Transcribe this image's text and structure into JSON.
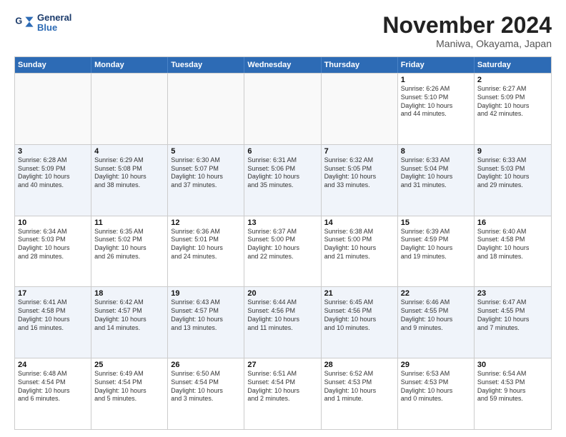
{
  "logo": {
    "line1": "General",
    "line2": "Blue"
  },
  "title": "November 2024",
  "location": "Maniwa, Okayama, Japan",
  "header_days": [
    "Sunday",
    "Monday",
    "Tuesday",
    "Wednesday",
    "Thursday",
    "Friday",
    "Saturday"
  ],
  "weeks": [
    [
      {
        "day": "",
        "info": ""
      },
      {
        "day": "",
        "info": ""
      },
      {
        "day": "",
        "info": ""
      },
      {
        "day": "",
        "info": ""
      },
      {
        "day": "",
        "info": ""
      },
      {
        "day": "1",
        "info": "Sunrise: 6:26 AM\nSunset: 5:10 PM\nDaylight: 10 hours\nand 44 minutes."
      },
      {
        "day": "2",
        "info": "Sunrise: 6:27 AM\nSunset: 5:09 PM\nDaylight: 10 hours\nand 42 minutes."
      }
    ],
    [
      {
        "day": "3",
        "info": "Sunrise: 6:28 AM\nSunset: 5:09 PM\nDaylight: 10 hours\nand 40 minutes."
      },
      {
        "day": "4",
        "info": "Sunrise: 6:29 AM\nSunset: 5:08 PM\nDaylight: 10 hours\nand 38 minutes."
      },
      {
        "day": "5",
        "info": "Sunrise: 6:30 AM\nSunset: 5:07 PM\nDaylight: 10 hours\nand 37 minutes."
      },
      {
        "day": "6",
        "info": "Sunrise: 6:31 AM\nSunset: 5:06 PM\nDaylight: 10 hours\nand 35 minutes."
      },
      {
        "day": "7",
        "info": "Sunrise: 6:32 AM\nSunset: 5:05 PM\nDaylight: 10 hours\nand 33 minutes."
      },
      {
        "day": "8",
        "info": "Sunrise: 6:33 AM\nSunset: 5:04 PM\nDaylight: 10 hours\nand 31 minutes."
      },
      {
        "day": "9",
        "info": "Sunrise: 6:33 AM\nSunset: 5:03 PM\nDaylight: 10 hours\nand 29 minutes."
      }
    ],
    [
      {
        "day": "10",
        "info": "Sunrise: 6:34 AM\nSunset: 5:03 PM\nDaylight: 10 hours\nand 28 minutes."
      },
      {
        "day": "11",
        "info": "Sunrise: 6:35 AM\nSunset: 5:02 PM\nDaylight: 10 hours\nand 26 minutes."
      },
      {
        "day": "12",
        "info": "Sunrise: 6:36 AM\nSunset: 5:01 PM\nDaylight: 10 hours\nand 24 minutes."
      },
      {
        "day": "13",
        "info": "Sunrise: 6:37 AM\nSunset: 5:00 PM\nDaylight: 10 hours\nand 22 minutes."
      },
      {
        "day": "14",
        "info": "Sunrise: 6:38 AM\nSunset: 5:00 PM\nDaylight: 10 hours\nand 21 minutes."
      },
      {
        "day": "15",
        "info": "Sunrise: 6:39 AM\nSunset: 4:59 PM\nDaylight: 10 hours\nand 19 minutes."
      },
      {
        "day": "16",
        "info": "Sunrise: 6:40 AM\nSunset: 4:58 PM\nDaylight: 10 hours\nand 18 minutes."
      }
    ],
    [
      {
        "day": "17",
        "info": "Sunrise: 6:41 AM\nSunset: 4:58 PM\nDaylight: 10 hours\nand 16 minutes."
      },
      {
        "day": "18",
        "info": "Sunrise: 6:42 AM\nSunset: 4:57 PM\nDaylight: 10 hours\nand 14 minutes."
      },
      {
        "day": "19",
        "info": "Sunrise: 6:43 AM\nSunset: 4:57 PM\nDaylight: 10 hours\nand 13 minutes."
      },
      {
        "day": "20",
        "info": "Sunrise: 6:44 AM\nSunset: 4:56 PM\nDaylight: 10 hours\nand 11 minutes."
      },
      {
        "day": "21",
        "info": "Sunrise: 6:45 AM\nSunset: 4:56 PM\nDaylight: 10 hours\nand 10 minutes."
      },
      {
        "day": "22",
        "info": "Sunrise: 6:46 AM\nSunset: 4:55 PM\nDaylight: 10 hours\nand 9 minutes."
      },
      {
        "day": "23",
        "info": "Sunrise: 6:47 AM\nSunset: 4:55 PM\nDaylight: 10 hours\nand 7 minutes."
      }
    ],
    [
      {
        "day": "24",
        "info": "Sunrise: 6:48 AM\nSunset: 4:54 PM\nDaylight: 10 hours\nand 6 minutes."
      },
      {
        "day": "25",
        "info": "Sunrise: 6:49 AM\nSunset: 4:54 PM\nDaylight: 10 hours\nand 5 minutes."
      },
      {
        "day": "26",
        "info": "Sunrise: 6:50 AM\nSunset: 4:54 PM\nDaylight: 10 hours\nand 3 minutes."
      },
      {
        "day": "27",
        "info": "Sunrise: 6:51 AM\nSunset: 4:54 PM\nDaylight: 10 hours\nand 2 minutes."
      },
      {
        "day": "28",
        "info": "Sunrise: 6:52 AM\nSunset: 4:53 PM\nDaylight: 10 hours\nand 1 minute."
      },
      {
        "day": "29",
        "info": "Sunrise: 6:53 AM\nSunset: 4:53 PM\nDaylight: 10 hours\nand 0 minutes."
      },
      {
        "day": "30",
        "info": "Sunrise: 6:54 AM\nSunset: 4:53 PM\nDaylight: 9 hours\nand 59 minutes."
      }
    ]
  ]
}
